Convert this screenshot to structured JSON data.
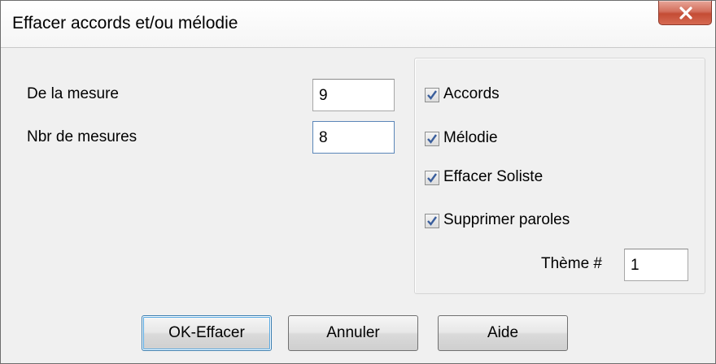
{
  "window": {
    "title": "Effacer accords et/ou mélodie"
  },
  "form": {
    "start_bar_label": "De la mesure",
    "start_bar_value": "9",
    "bar_count_label": "Nbr de mesures",
    "bar_count_value": "8"
  },
  "options": {
    "chords_label": "Accords",
    "chords_checked": true,
    "melody_label": "Mélodie",
    "melody_checked": true,
    "soloist_label": "Effacer Soliste",
    "soloist_checked": true,
    "lyrics_label": "Supprimer paroles",
    "lyrics_checked": true,
    "theme_label": "Thème #",
    "theme_value": "1"
  },
  "buttons": {
    "ok_label": "OK-Effacer",
    "cancel_label": "Annuler",
    "help_label": "Aide"
  },
  "icons": {
    "close": "close-icon",
    "check": "checkmark-icon"
  },
  "colors": {
    "close_button": "#c44c35",
    "checkmark": "#3a5e9c",
    "default_button_border": "#3c7fb1"
  }
}
